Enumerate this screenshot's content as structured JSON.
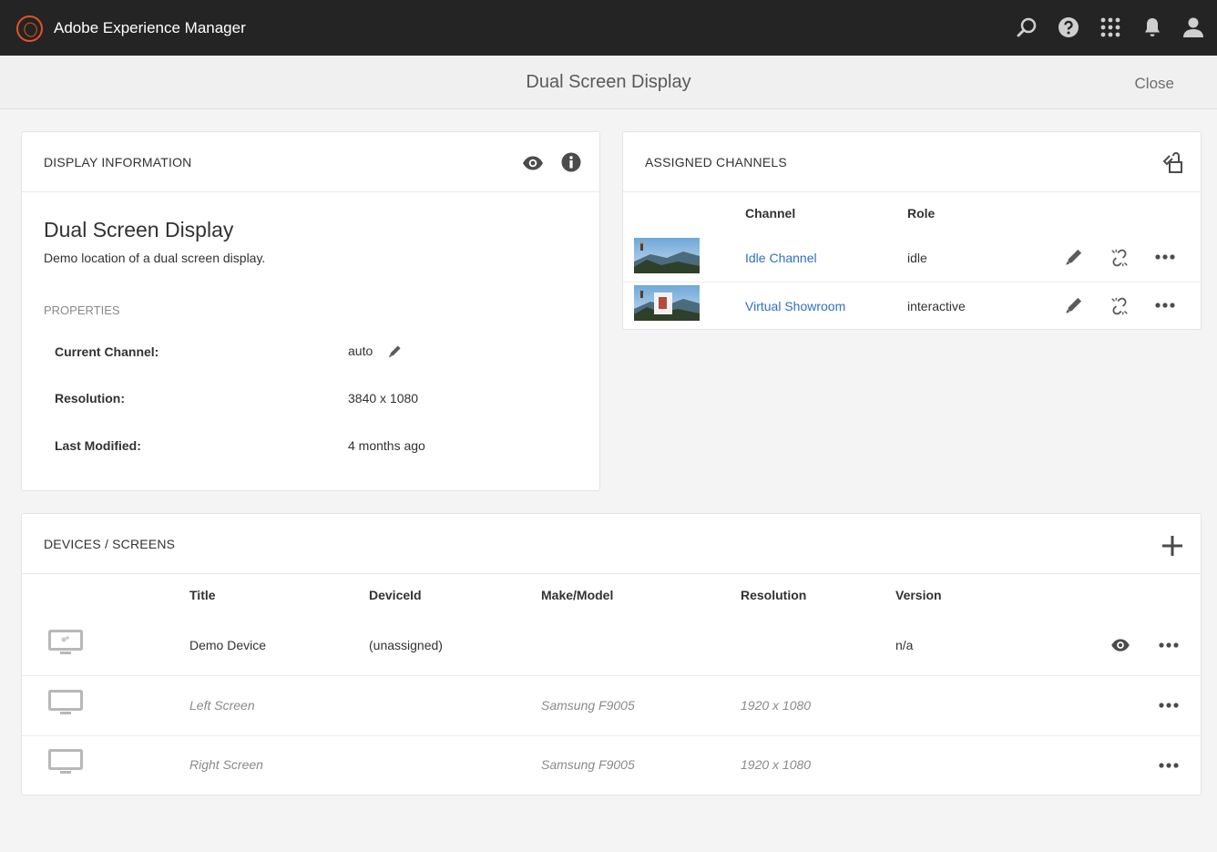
{
  "app": {
    "title": "Adobe Experience Manager"
  },
  "page": {
    "title": "Dual Screen Display",
    "close_label": "Close"
  },
  "display_info": {
    "section_title": "DISPLAY INFORMATION",
    "name": "Dual Screen Display",
    "description": "Demo location of a dual screen display.",
    "properties_label": "PROPERTIES",
    "properties": [
      {
        "key": "Current Channel:",
        "value": "auto"
      },
      {
        "key": "Resolution:",
        "value": "3840 x 1080"
      },
      {
        "key": "Last Modified:",
        "value": "4 months ago"
      }
    ]
  },
  "channels": {
    "section_title": "ASSIGNED CHANNELS",
    "headers": {
      "channel": "Channel",
      "role": "Role"
    },
    "rows": [
      {
        "name": "Idle Channel",
        "role": "idle"
      },
      {
        "name": "Virtual Showroom",
        "role": "interactive"
      }
    ]
  },
  "devices": {
    "section_title": "DEVICES / SCREENS",
    "headers": {
      "title": "Title",
      "device_id": "DeviceId",
      "make_model": "Make/Model",
      "resolution": "Resolution",
      "version": "Version"
    },
    "rows": [
      {
        "title": "Demo Device",
        "device_id": "(unassigned)",
        "make_model": "",
        "resolution": "",
        "version": "n/a"
      },
      {
        "title": "Left Screen",
        "device_id": "",
        "make_model": "Samsung F9005",
        "resolution": "1920 x 1080",
        "version": ""
      },
      {
        "title": "Right Screen",
        "device_id": "",
        "make_model": "Samsung F9005",
        "resolution": "1920 x 1080",
        "version": ""
      }
    ]
  },
  "colors": {
    "topbar": "#242424",
    "brand": "#e45426",
    "link": "#2f6ec8",
    "background": "#f4f4f4"
  }
}
